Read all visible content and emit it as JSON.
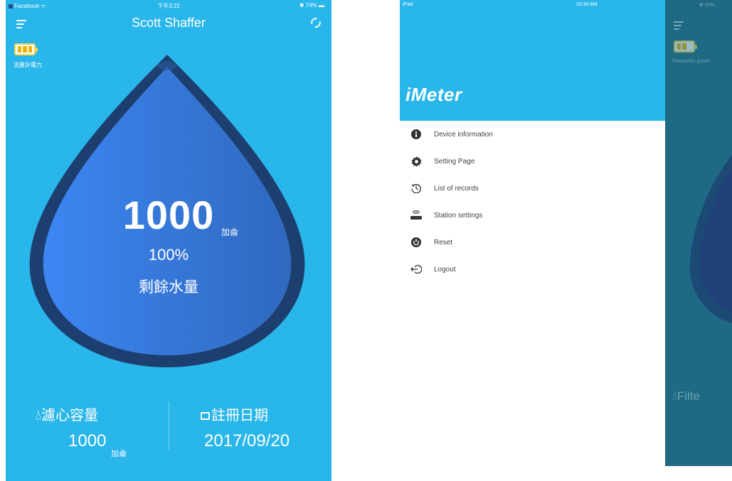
{
  "left_screen": {
    "status": {
      "carrier": "Facebook",
      "time": "下午3:22",
      "battery": "74%"
    },
    "title": "Scott Shaffer",
    "battery_label": "流量計電力",
    "remaining_value": "1000",
    "remaining_unit": "加侖",
    "remaining_percent": "100%",
    "remaining_label": "剩餘水量",
    "filter_capacity_label": "濾心容量",
    "filter_capacity_value": "1000",
    "filter_capacity_unit": "加侖",
    "register_date_label": "註冊日期",
    "register_date_value": "2017/09/20"
  },
  "right_screen": {
    "status": {
      "device": "iPad",
      "time": "10:34 AM",
      "battery": "80%"
    },
    "logo": "iMeter",
    "menu": [
      {
        "label": "Device information",
        "icon": "info-icon"
      },
      {
        "label": "Setting Page",
        "icon": "gear-icon"
      },
      {
        "label": "List of records",
        "icon": "history-icon"
      },
      {
        "label": "Station settings",
        "icon": "router-icon"
      },
      {
        "label": "Reset",
        "icon": "power-icon"
      },
      {
        "label": "Logout",
        "icon": "logout-icon"
      }
    ],
    "behind": {
      "battery_label": "Flowmeter power",
      "filter_label": "Filte"
    }
  },
  "colors": {
    "sky": "#29b6ea",
    "drop_dark": "#1d3f70",
    "drop_fill": "#3a7ee0",
    "battery": "#f0b400",
    "overlay": "#1e6a85"
  }
}
